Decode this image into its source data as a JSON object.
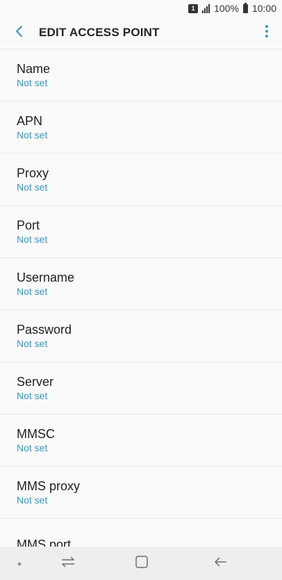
{
  "status_bar": {
    "sim": "1",
    "battery": "100%",
    "time": "10:00",
    "icons": [
      "sim-icon",
      "signal-icon",
      "battery-icon"
    ]
  },
  "app_bar": {
    "title": "EDIT ACCESS POINT",
    "back_icon": "chevron-left-icon",
    "more_icon": "more-vert-icon",
    "accent_color": "#3a95c2"
  },
  "items": [
    {
      "label": "Name",
      "value": "Not set"
    },
    {
      "label": "APN",
      "value": "Not set"
    },
    {
      "label": "Proxy",
      "value": "Not set"
    },
    {
      "label": "Port",
      "value": "Not set"
    },
    {
      "label": "Username",
      "value": "Not set"
    },
    {
      "label": "Password",
      "value": "Not set"
    },
    {
      "label": "Server",
      "value": "Not set"
    },
    {
      "label": "MMSC",
      "value": "Not set"
    },
    {
      "label": "MMS proxy",
      "value": "Not set"
    },
    {
      "label": "MMS port",
      "value": ""
    }
  ],
  "nav_bar": {
    "icons": [
      "dot-icon",
      "recent-apps-icon",
      "home-icon",
      "back-arrow-icon"
    ]
  }
}
